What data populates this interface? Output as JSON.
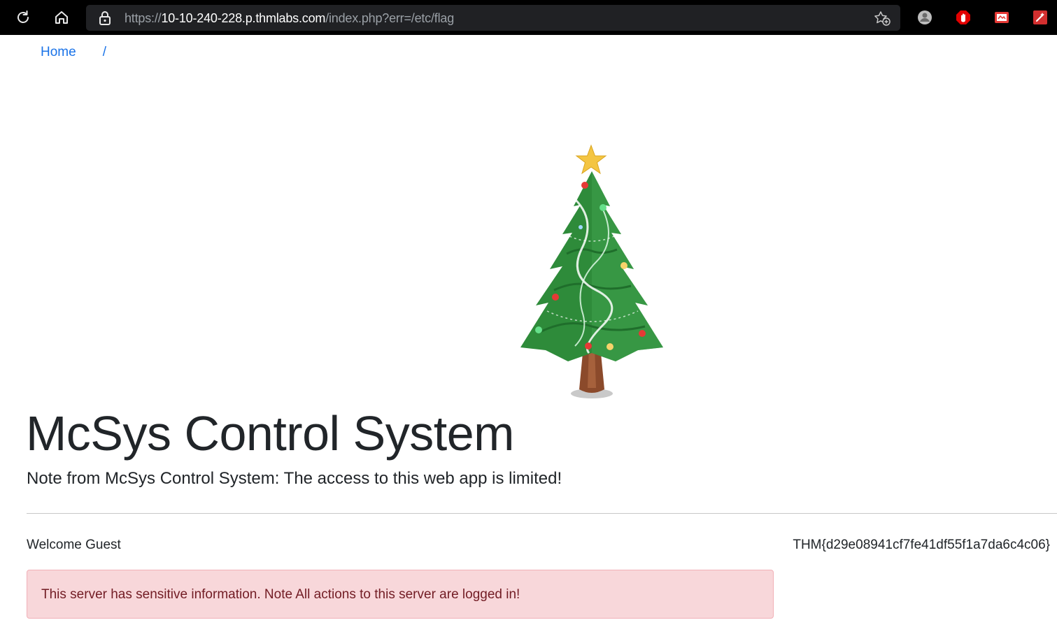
{
  "browser": {
    "url": {
      "scheme": "https://",
      "host": "10-10-240-228.p.thmlabs.com",
      "path": "/index.php?err=/etc/flag"
    },
    "icons": {
      "reload": "reload-icon",
      "home": "home-icon",
      "lock": "lock-icon",
      "favorite": "add-favorite-icon",
      "extensions": [
        "profile-extension-icon",
        "adblock-extension-icon",
        "pdf-extension-icon",
        "tool-extension-icon"
      ]
    }
  },
  "breadcrumb": {
    "home": "Home",
    "separator": "/"
  },
  "hero": {
    "title": "McSys Control System",
    "subtitle": "Note from McSys Control System: The access to this web app is limited!"
  },
  "user": {
    "welcome": "Welcome Guest"
  },
  "flag": "THM{d29e08941cf7fe41df55f1a7da6c4c06}",
  "alert": {
    "message": "This server has sensitive information. Note All actions to this server are logged in!"
  },
  "colors": {
    "link": "#1a73e8",
    "alert_bg": "#f8d7da",
    "alert_text": "#721c24",
    "tree_green": "#2e8b3a",
    "star": "#f4c542"
  }
}
